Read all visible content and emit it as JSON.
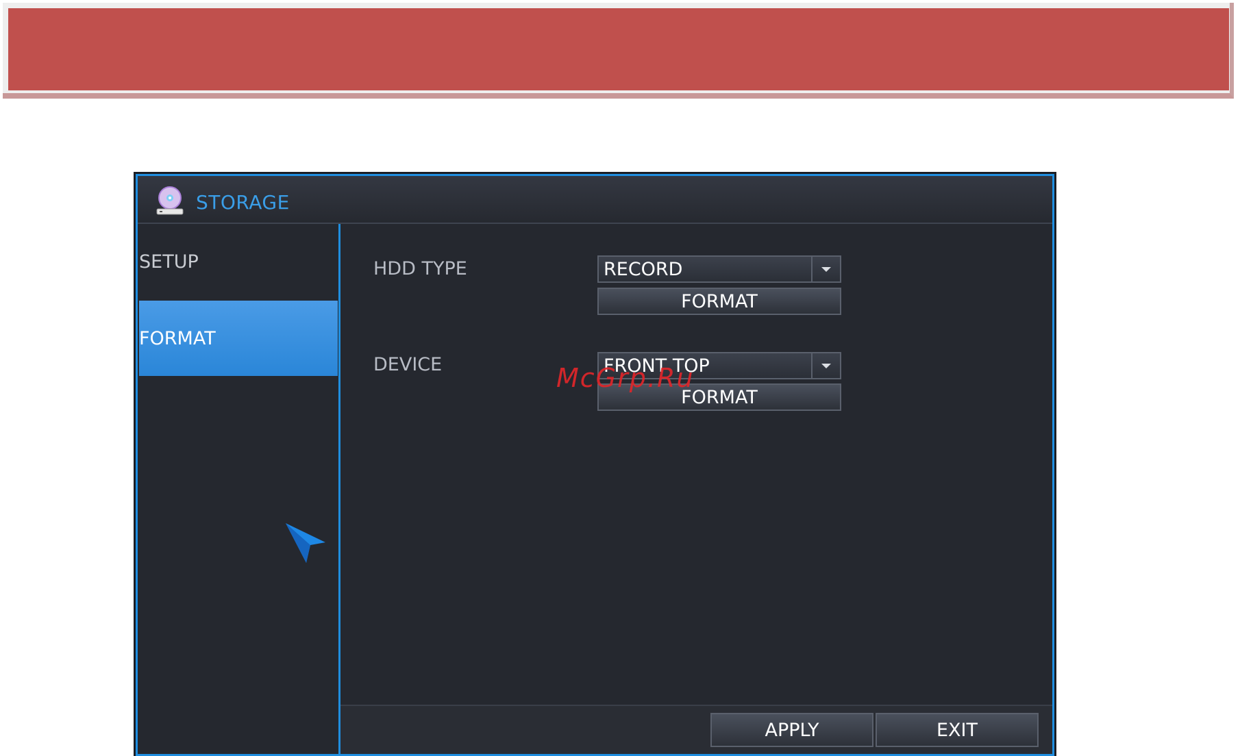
{
  "window": {
    "title": "STORAGE",
    "title_icon": "storage-disc-icon"
  },
  "sidebar": {
    "items": [
      {
        "label": "SETUP",
        "selected": false
      },
      {
        "label": "FORMAT",
        "selected": true
      }
    ]
  },
  "form": {
    "hdd_type": {
      "label": "HDD TYPE",
      "value": "RECORD",
      "button_label": "FORMAT"
    },
    "device": {
      "label": "DEVICE",
      "value": "FRONT TOP",
      "button_label": "FORMAT"
    }
  },
  "footer": {
    "apply_label": "APPLY",
    "exit_label": "EXIT"
  },
  "watermark": "McGrp.Ru",
  "colors": {
    "banner": "#c0504d",
    "accent": "#1f8ee0",
    "selected_item": "#3a92e0",
    "panel_bg": "#25282f"
  }
}
